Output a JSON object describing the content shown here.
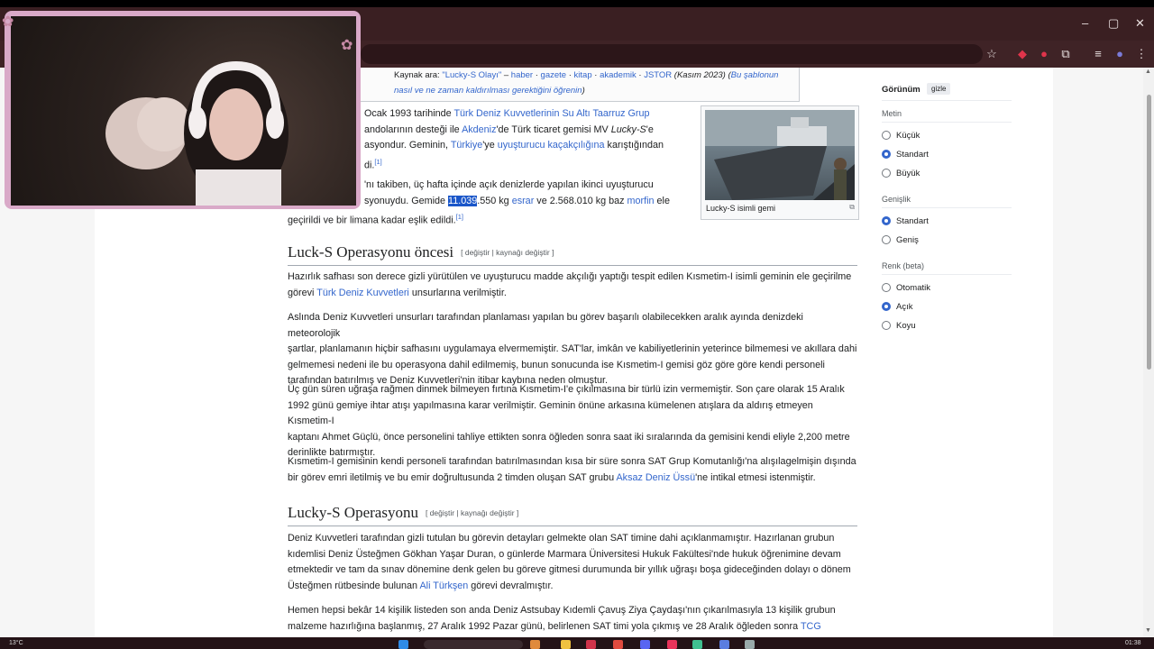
{
  "source_box": {
    "prefix": "Kaynak ara: ",
    "query": "\"Lucky-S Olayı\"",
    "sep": " – ",
    "links": [
      "haber",
      "gazete",
      "kitap",
      "akademik",
      "JSTOR"
    ],
    "date": "(Kasım 2023)",
    "help": "Bu şablonun nasıl ve ne zaman kaldırılması gerektiğini öğrenin"
  },
  "intro": {
    "p1_a": "Ocak 1993 tarihinde ",
    "p1_link1": "Türk Deniz Kuvvetlerinin Su Altı Taarruz Grup",
    "p1_b": "andolarının desteği ile ",
    "p1_link2": "Akdeniz",
    "p1_c": "'de Türk ticaret gemisi MV ",
    "p1_italic": "Lucky-S",
    "p1_d": "'e",
    "p1_e": "asyondur. Geminin, ",
    "p1_link3": "Türkiye",
    "p1_f": "'ye ",
    "p1_link4": "uyuşturucu kaçakçılığına",
    "p1_g": " karıştığından",
    "p1_h": "di.",
    "p1_ref": "[1]",
    "p2_a": "'nı takiben, üç hafta içinde açık denizlerde yapılan ikinci uyuşturucu",
    "p2_b": "syonuydu. Gemide ",
    "p2_sel": "11.039",
    "p2_c": ".550 kg ",
    "p2_link1": "esrar",
    "p2_d": " ve 2.568.010 kg baz ",
    "p2_link2": "morfin",
    "p2_e": " ele",
    "p2_f": "geçirildi ve bir limana kadar eşlik edildi.",
    "p2_ref": "[1]"
  },
  "thumb": {
    "caption": "Lucky-S isimli gemi",
    "enlarge": "⧉"
  },
  "section1": {
    "title": "Luck-S Operasyonu öncesi",
    "edit": "[ değiştir | kaynağı değiştir ]",
    "p1_a": "Hazırlık safhası son derece gizli yürütülen ve uyuşturucu madde akçılığı yaptığı tespit edilen Kısmetim-I isimli geminin ele geçirilme",
    "p1_b": "görevi ",
    "p1_link": "Türk Deniz Kuvvetleri",
    "p1_c": " unsurlarına verilmiştir.",
    "p2_l1": "Aslında Deniz Kuvvetleri unsurları tarafından planlaması yapılan bu görev başarılı olabilecekken aralık ayında denizdeki meteorolojik",
    "p2_l2": "şartlar, planlamanın hiçbir safhasını uygulamaya elvermemiştir. SAT'lar, imkân ve kabiliyetlerinin yeterince bilmemesi ve akıllara dahi",
    "p2_l3": "gelmemesi nedeni ile bu operasyona dahil edilmemiş, bunun sonucunda ise Kısmetim-I gemisi göz göre göre kendi personeli",
    "p2_l4": "tarafından batırılmış ve Deniz Kuvvetleri'nin itibar kaybına neden olmuştur.",
    "p3_l1": "Üç gün süren uğraşa rağmen dinmek bilmeyen fırtına Kısmetim-I'e çıkılmasına bir türlü izin vermemiştir. Son çare olarak 15 Aralık",
    "p3_l2": "1992 günü gemiye ihtar atışı yapılmasına karar verilmiştir. Geminin önüne arkasına kümelenen atışlara da aldırış etmeyen Kısmetim-I",
    "p3_l3": "kaptanı Ahmet Güçlü, önce personelini tahliye ettikten sonra öğleden sonra saat iki sıralarında da gemisini kendi eliyle 2,200 metre",
    "p3_l4": "derinlikte batırmıştır.",
    "p4_l1": "Kısmetim-I gemisinin kendi personeli tarafından batırılmasından kısa bir süre sonra SAT Grup Komutanlığı'na alışılagelmişin dışında",
    "p4_l2a": "bir görev emri iletilmiş ve bu emir doğrultusunda 2 timden oluşan SAT grubu ",
    "p4_link": "Aksaz Deniz Üssü",
    "p4_l2b": "'ne intikal etmesi istenmiştir."
  },
  "section2": {
    "title": "Lucky-S Operasyonu",
    "edit": "[ değiştir | kaynağı değiştir ]",
    "p1_l1": "Deniz Kuvvetleri tarafından gizli tutulan bu görevin detayları gelmekte olan SAT timine dahi açıklanmamıştır. Hazırlanan grubun",
    "p1_l2": "kıdemlisi Deniz Üsteğmen Gökhan Yaşar Duran, o günlerde Marmara Üniversitesi Hukuk Fakültesi'nde hukuk öğrenimine devam",
    "p1_l3": "etmektedir ve tam da sınav dönemine denk gelen bu göreve gitmesi durumunda bir yıllık uğraşı boşa gideceğinden dolayı o dönem",
    "p1_l4a": "Üsteğmen rütbesinde bulunan ",
    "p1_link": "Ali Türkşen",
    "p1_l4b": " görevi devralmıştır.",
    "p2_l1": "Hemen hepsi bekâr 14 kişilik listeden son anda Deniz Astsubay Kıdemli Çavuş Ziya Çaydaşı'nın çıkarılmasıyla 13 kişilik grubun",
    "p2_l2a": "malzeme hazırlığına başlanmış, 27 Aralık 1992 Pazar günü, belirlenen SAT timi yola çıkmış ve 28 Aralık öğleden sonra ",
    "p2_link": "TCG"
  },
  "sidebar": {
    "heading": "Görünüm",
    "hide": "gizle",
    "text_section": "Metin",
    "text_options": [
      "Küçük",
      "Standart",
      "Büyük"
    ],
    "width_section": "Genişlik",
    "width_options": [
      "Standart",
      "Geniş"
    ],
    "color_section": "Renk (beta)",
    "color_options": [
      "Otomatik",
      "Açık",
      "Koyu"
    ]
  },
  "taskbar": {
    "weather": "13°C",
    "time": "01:38"
  },
  "colors": {
    "link": "#3366cc",
    "selection": "#1a56c9",
    "titlebar": "#3a1f22",
    "webcam_frame": "#d9a9c8"
  }
}
